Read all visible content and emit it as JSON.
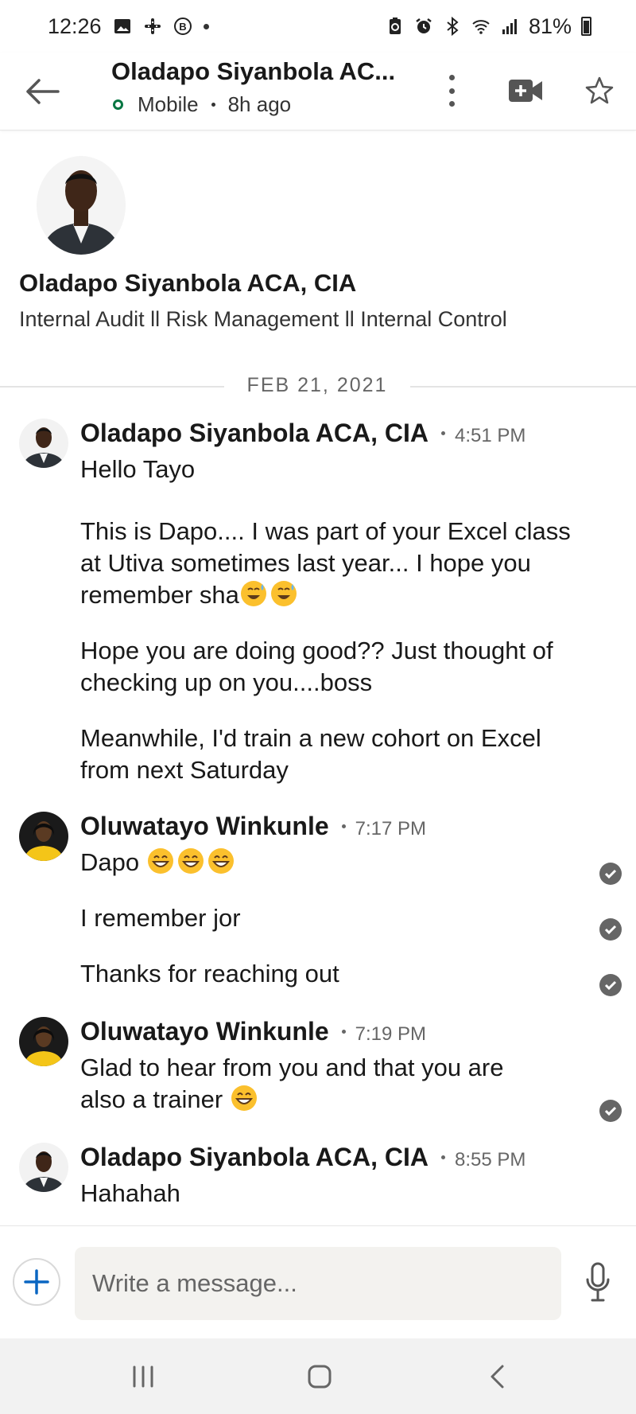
{
  "status_bar": {
    "time": "12:26",
    "battery": "81%"
  },
  "header": {
    "name": "Oladapo Siyanbola AC...",
    "presence": "Mobile",
    "last_seen": "8h ago"
  },
  "profile": {
    "name": "Oladapo Siyanbola ACA, CIA",
    "headline": "Internal Audit ll Risk Management ll Internal Control"
  },
  "date_divider": "FEB 21, 2021",
  "messages": [
    {
      "sender": "Oladapo Siyanbola ACA, CIA",
      "time": "4:51 PM",
      "lines": [
        "Hello Tayo",
        "This is Dapo.... I was part of your Excel class at Utiva sometimes last year... I hope you remember sha",
        "Hope you are doing good?? Just thought of checking up on you....boss",
        "Meanwhile, I'd train a new cohort on Excel from next Saturday"
      ]
    },
    {
      "sender": "Oluwatayo Winkunle",
      "time": "7:17 PM",
      "lines": [
        "Dapo",
        "I remember jor",
        "Thanks for reaching out"
      ]
    },
    {
      "sender": "Oluwatayo Winkunle",
      "time": "7:19 PM",
      "lines": [
        "Glad to hear from you and that you are also a trainer"
      ]
    },
    {
      "sender": "Oladapo Siyanbola ACA, CIA",
      "time": "8:55 PM",
      "lines": [
        "Hahahah"
      ]
    }
  ],
  "composer": {
    "placeholder": "Write a message..."
  },
  "colors": {
    "online": "#057642",
    "accent": "#0a66c2",
    "check": "#666666"
  },
  "icons": [
    "back-arrow-icon",
    "more-vertical-icon",
    "video-call-icon",
    "star-icon",
    "add-icon",
    "microphone-icon",
    "sweat-smile-emoji",
    "grin-emoji",
    "read-check-icon"
  ]
}
